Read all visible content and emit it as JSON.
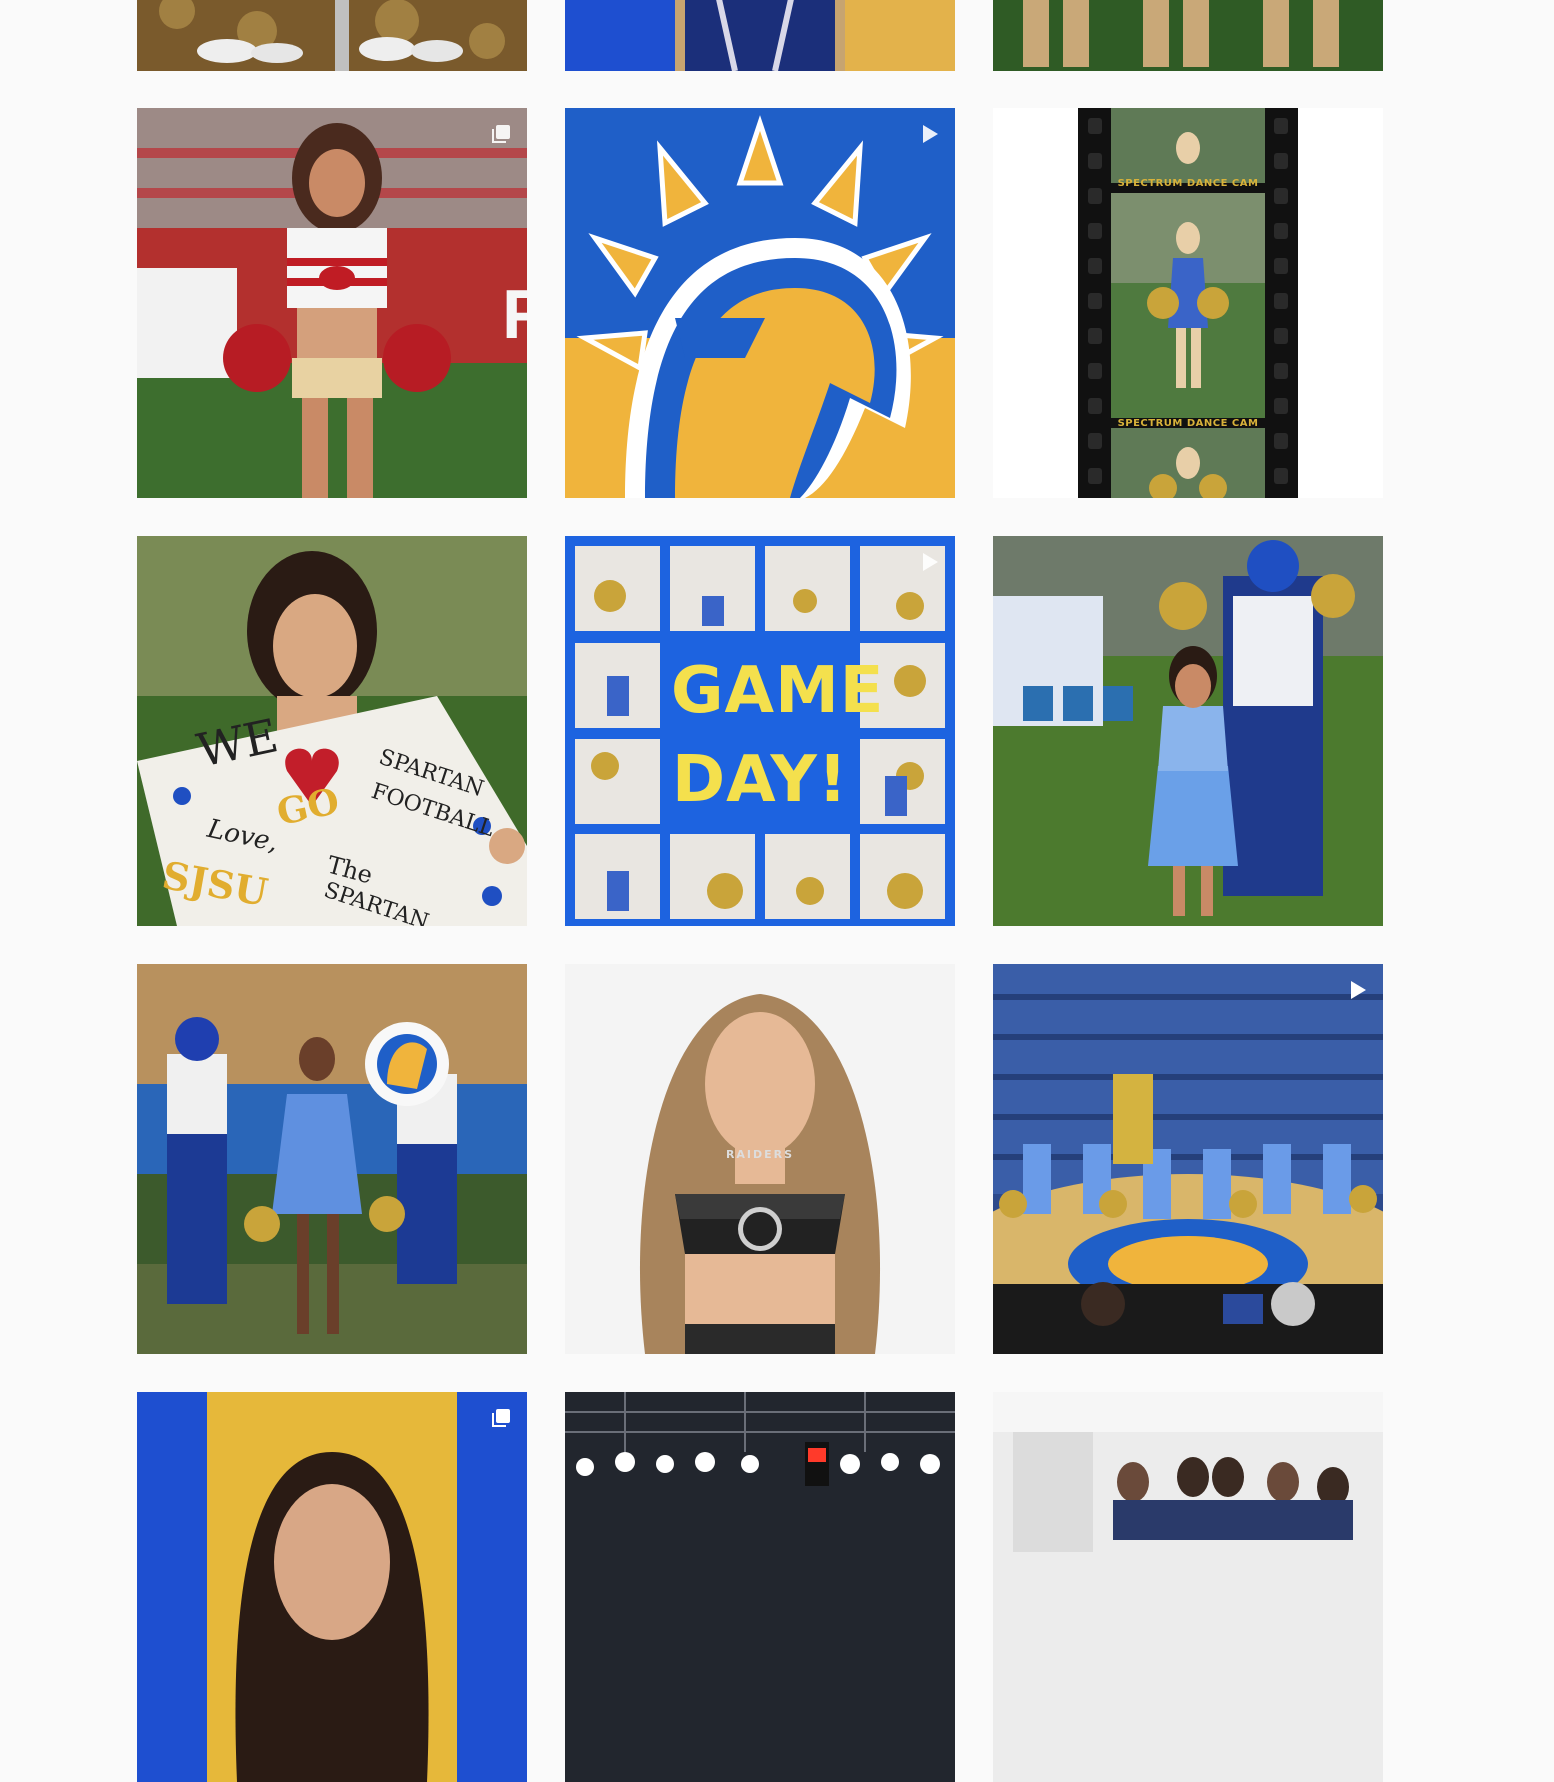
{
  "feed": {
    "posts": [
      {
        "badge": "none"
      },
      {
        "badge": "none"
      },
      {
        "badge": "none"
      },
      {
        "badge": "carousel-icon"
      },
      {
        "badge": "video-icon"
      },
      {
        "badge": "none"
      },
      {
        "badge": "none"
      },
      {
        "badge": "video-icon",
        "headline_1": "GAME",
        "headline_2": "DAY!"
      },
      {
        "badge": "none"
      },
      {
        "badge": "none"
      },
      {
        "badge": "none",
        "jersey_text": "RAIDERS"
      },
      {
        "badge": "video-icon"
      },
      {
        "badge": "carousel-icon"
      },
      {
        "badge": "none"
      },
      {
        "badge": "none"
      }
    ],
    "film_caption_top": "SPECTRUM DANCE CAM",
    "film_caption_bottom": "SPECTRUM DANCE CAM",
    "sign": {
      "line1": "WE",
      "line2": "GO",
      "line3": "SPARTAN",
      "line4": "FOOTBALL",
      "line5": "Love,",
      "line6": "The",
      "line7": "SJSU",
      "line8": "SPARTAN"
    }
  },
  "colors": {
    "sjsu_blue": "#1f5fc8",
    "sjsu_gold": "#f0b43c",
    "page_bg": "#fafafa"
  }
}
